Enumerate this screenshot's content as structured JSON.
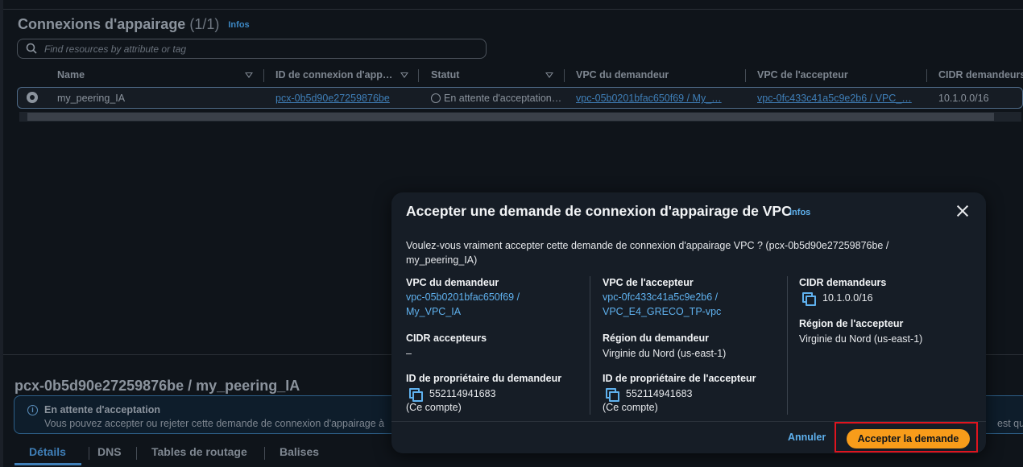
{
  "background": {
    "panel": {
      "title": "Connexions d'appairage",
      "count": "(1/1)",
      "infos": "Infos",
      "search_placeholder": "Find resources by attribute or tag"
    },
    "table": {
      "headers": [
        "Name",
        "ID de connexion d'app…",
        "Statut",
        "VPC du demandeur",
        "VPC de l'accepteur",
        "CIDR demandeurs"
      ],
      "row": {
        "name": "my_peering_IA",
        "id": "pcx-0b5d90e27259876be",
        "status": "En attente d'acceptation…",
        "requester_vpc": "vpc-05b0201bfac650f69 / My_…",
        "accepter_vpc": "vpc-0fc433c41a5c9e2b6 / VPC_…",
        "requester_cidr": "10.1.0.0/16"
      }
    },
    "details": {
      "title": "pcx-0b5d90e27259876be / my_peering_IA",
      "alert_title": "En attente d'acceptation",
      "alert_desc": "Vous pouvez accepter ou rejeter cette demande de connexion d'appairage à",
      "alert_desc_right": "est qu'ell",
      "tabs": [
        "Détails",
        "DNS",
        "Tables de routage",
        "Balises"
      ]
    }
  },
  "modal": {
    "title": "Accepter une demande de connexion d'appairage de VPC",
    "infos": "Infos",
    "question": "Voulez-vous vraiment accepter cette demande de connexion d'appairage VPC ? (pcx-0b5d90e27259876be / my_peering_IA)",
    "col1": {
      "requester_vpc_label": "VPC du demandeur",
      "requester_vpc_line1": "vpc-05b0201bfac650f69 /",
      "requester_vpc_line2": "My_VPC_IA",
      "accepter_cidr_label": "CIDR accepteurs",
      "accepter_cidr_value": "–",
      "requester_owner_label": "ID de propriétaire du demandeur",
      "requester_owner_value": "552114941683",
      "requester_owner_note": "(Ce compte)"
    },
    "col2": {
      "accepter_vpc_label": "VPC de l'accepteur",
      "accepter_vpc_line1": "vpc-0fc433c41a5c9e2b6 /",
      "accepter_vpc_line2": "VPC_E4_GRECO_TP-vpc",
      "requester_region_label": "Région du demandeur",
      "requester_region_value": "Virginie du Nord (us-east-1)",
      "accepter_owner_label": "ID de propriétaire de l'accepteur",
      "accepter_owner_value": "552114941683",
      "accepter_owner_note": "(Ce compte)"
    },
    "col3": {
      "requester_cidr_label": "CIDR demandeurs",
      "requester_cidr_value": "10.1.0.0/16",
      "accepter_region_label": "Région de l'accepteur",
      "accepter_region_value": "Virginie du Nord (us-east-1)"
    },
    "cancel_label": "Annuler",
    "accept_label": "Accepter la demande"
  },
  "colors": {
    "accent_link": "#5fb1ee",
    "primary_button": "#f89c1a",
    "highlight_box": "#e0141e"
  }
}
